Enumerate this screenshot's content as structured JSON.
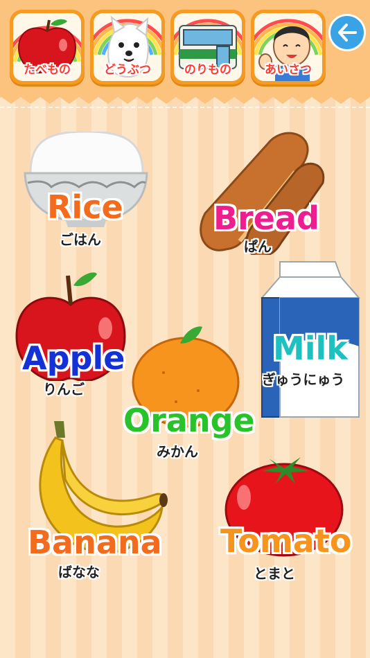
{
  "tabs": [
    {
      "label": "たべもの",
      "icon": "apple-icon"
    },
    {
      "label": "どうぶつ",
      "icon": "dog-icon"
    },
    {
      "label": "のりもの",
      "icon": "bus-icon"
    },
    {
      "label": "あいさつ",
      "icon": "boy-icon"
    }
  ],
  "back_button": {
    "icon": "arrow-left-icon"
  },
  "foods": [
    {
      "en": "Rice",
      "jp": "ごはん",
      "color": "#f36b1c"
    },
    {
      "en": "Bread",
      "jp": "ぱん",
      "color": "#ee1e8f"
    },
    {
      "en": "Apple",
      "jp": "りんご",
      "color": "#1431d6"
    },
    {
      "en": "Milk",
      "jp": "ぎゅうにゅう",
      "color": "#1fc0c0"
    },
    {
      "en": "Orange",
      "jp": "みかん",
      "color": "#28c22a"
    },
    {
      "en": "Banana",
      "jp": "ばなな",
      "color": "#f36b1c"
    },
    {
      "en": "Tomato",
      "jp": "とまと",
      "color": "#f7941d"
    }
  ]
}
